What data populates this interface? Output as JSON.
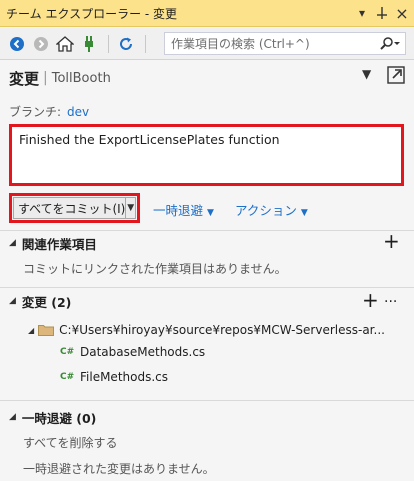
{
  "title_bar": {
    "title": "チーム エクスプローラー - 変更",
    "dropdown_glyph": "▾",
    "pin_glyph": "⊥",
    "close_glyph": "×"
  },
  "toolbar": {
    "search_placeholder": "作業項目の検索 (Ctrl+^)"
  },
  "header": {
    "title": "変更",
    "separator": "|",
    "repo": "TollBooth",
    "dropdown_glyph": "▼"
  },
  "branch": {
    "label": "ブランチ:",
    "value": "dev"
  },
  "commit": {
    "message": "Finished the ExportLicensePlates function",
    "commit_all_label": "すべてをコミット(I)",
    "stash_label": "一時退避",
    "actions_label": "アクション"
  },
  "related_work_items": {
    "title": "関連作業項目",
    "empty_text": "コミットにリンクされた作業項目はありません。"
  },
  "changes": {
    "title": "変更 (2)",
    "folder_path": "C:¥Users¥hiroyay¥source¥repos¥MCW-Serverless-ar...",
    "files": [
      {
        "icon": "C#",
        "name": "DatabaseMethods.cs"
      },
      {
        "icon": "C#",
        "name": "FileMethods.cs"
      }
    ]
  },
  "stashes": {
    "title": "一時退避 (0)",
    "delete_all_label": "すべてを削除する",
    "empty_text": "一時退避された変更はありません。"
  },
  "colors": {
    "title_bar": "#fce28a",
    "highlight_border": "#e3151d",
    "link": "#1e6fc8",
    "csharp_icon": "#388a34"
  }
}
